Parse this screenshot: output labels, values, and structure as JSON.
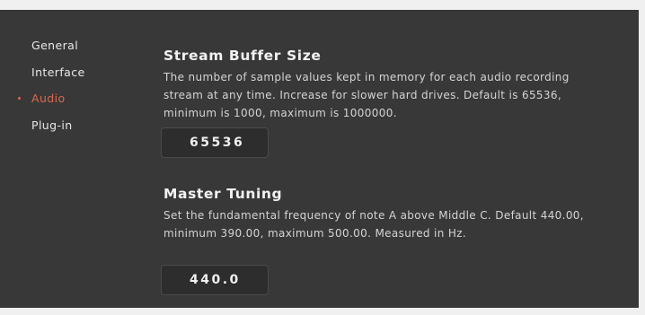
{
  "sidebar": {
    "items": [
      {
        "label": "General"
      },
      {
        "label": "Interface"
      },
      {
        "label": "Audio"
      },
      {
        "label": "Plug-in"
      }
    ],
    "active_index": 2,
    "active_color": "#d9684e"
  },
  "stream_buffer": {
    "title": "Stream Buffer Size",
    "description": "The number of sample values kept in memory for each audio recording stream at any time. Increase for slower hard drives. Default is 65536, minimum is 1000, maximum is 1000000.",
    "value": "65536"
  },
  "master_tuning": {
    "title": "Master Tuning",
    "description": "Set the fundamental frequency of note A above Middle C. Default 440.00, minimum 390.00, maximum 500.00. Measured in Hz.",
    "value": "440.0"
  }
}
